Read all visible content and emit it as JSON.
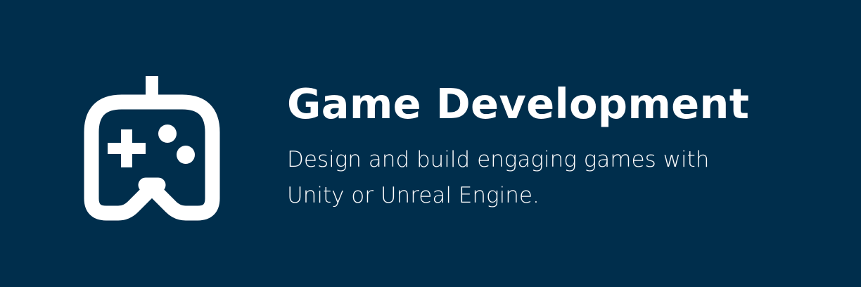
{
  "banner": {
    "background_color": "#002e4c",
    "foreground_color": "#ffffff",
    "icon": "game-controller-icon",
    "title": "Game Development",
    "description": "Design and build engaging games with Unity or Unreal Engine."
  }
}
